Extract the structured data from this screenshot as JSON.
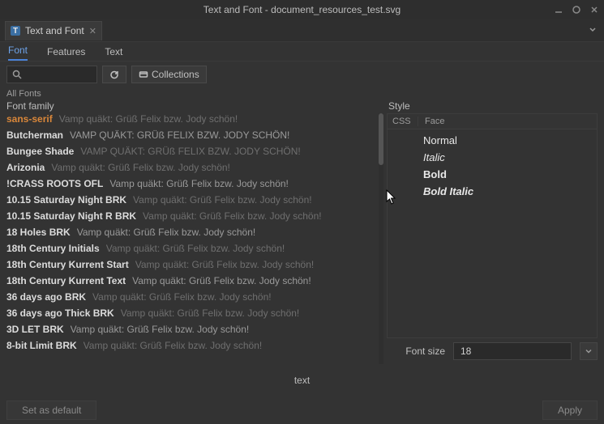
{
  "window": {
    "title": "Text and Font - document_resources_test.svg"
  },
  "tab": {
    "label": "Text and Font"
  },
  "subnav": {
    "font": "Font",
    "features": "Features",
    "text": "Text"
  },
  "toolbar": {
    "collections_label": "Collections"
  },
  "all_fonts_label": "All Fonts",
  "family_header": "Font family",
  "style_header": "Style",
  "style_columns": {
    "css": "CSS",
    "face": "Face"
  },
  "styles": {
    "normal": "Normal",
    "italic": "Italic",
    "bold": "Bold",
    "bolditalic": "Bold Italic"
  },
  "fontsize": {
    "label": "Font size",
    "value": "18"
  },
  "preview_text": "text",
  "buttons": {
    "set_default": "Set as default",
    "apply": "Apply"
  },
  "fonts": [
    {
      "name": "sans-serif",
      "sample": "Vamp quäkt: Grüß Felix bzw. Jody schön!",
      "selected": true
    },
    {
      "name": "Butcherman",
      "sample": "VAMP QUÄKT: GRÜß FELIX BZW. JODY SCHÖN!"
    },
    {
      "name": "Bungee Shade",
      "sample": "VAMP QUÄKT: GRÜß FELIX BZW. JODY SCHÖN!"
    },
    {
      "name": "Arizonia",
      "sample": "Vamp quäkt: Grüß Felix bzw. Jody schön!"
    },
    {
      "name": "!CRASS ROOTS OFL",
      "sample": "Vamp quäkt: Grüß Felix bzw. Jody schön!"
    },
    {
      "name": "10.15 Saturday Night BRK",
      "sample": "Vamp quäkt: Grüß Felix bzw. Jody schön!"
    },
    {
      "name": "10.15 Saturday Night R BRK",
      "sample": "Vamp quäkt: Grüß Felix bzw. Jody schön!"
    },
    {
      "name": "18 Holes BRK",
      "sample": "Vamp quäkt: Grüß Felix bzw. Jody schön!"
    },
    {
      "name": "18th Century Initials",
      "sample": "Vamp quäkt: Grüß Felix bzw. Jody schön!"
    },
    {
      "name": "18th Century Kurrent Start",
      "sample": "Vamp quäkt: Grüß Felix bzw. Jody schön!"
    },
    {
      "name": "18th Century Kurrent Text",
      "sample": "Vamp quäkt: Grüß Felix bzw. Jody schön!"
    },
    {
      "name": "36 days ago BRK",
      "sample": "Vamp quäkt: Grüß Felix bzw. Jody schön!"
    },
    {
      "name": "36 days ago Thick BRK",
      "sample": "Vamp quäkt: Grüß Felix bzw. Jody schön!"
    },
    {
      "name": "3D LET BRK",
      "sample": "Vamp quäkt: Grüß Felix bzw. Jody schön!"
    },
    {
      "name": "8-bit Limit BRK",
      "sample": "Vamp quäkt: Grüß Felix bzw. Jody schön!"
    }
  ]
}
